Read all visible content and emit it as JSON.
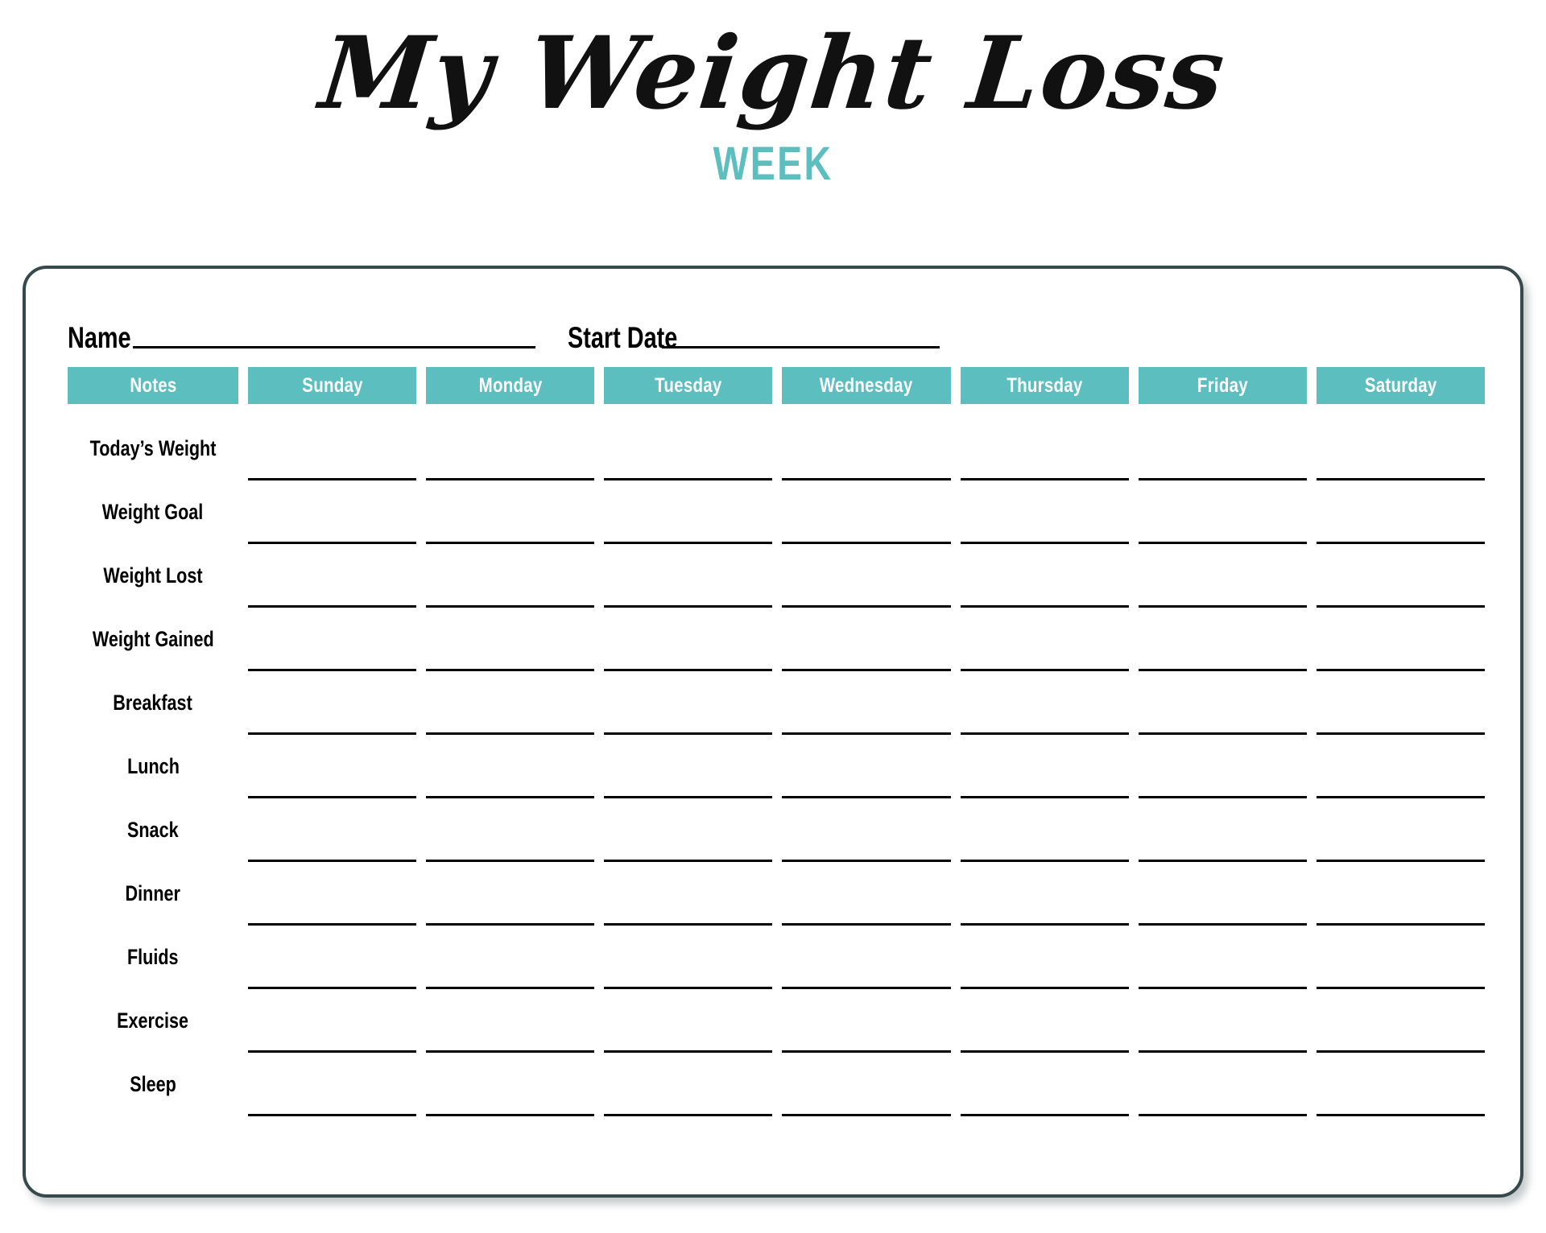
{
  "title": {
    "main": "My Weight Loss",
    "sub": "WEEK"
  },
  "colors": {
    "accent_teal": "#5DBEC0",
    "card_border": "#36494D",
    "text": "#000000",
    "header_text": "#FFFFFF"
  },
  "meta": {
    "name_label": "Name",
    "name_value": "",
    "start_date_label": "Start Date",
    "start_date_value": ""
  },
  "table": {
    "columns": [
      {
        "label": "Notes"
      },
      {
        "label": "Sunday"
      },
      {
        "label": "Monday"
      },
      {
        "label": "Tuesday"
      },
      {
        "label": "Wednesday"
      },
      {
        "label": "Thursday"
      },
      {
        "label": "Friday"
      },
      {
        "label": "Saturday"
      }
    ],
    "rows": [
      {
        "label": "Today’s Weight",
        "values": [
          "",
          "",
          "",
          "",
          "",
          "",
          ""
        ]
      },
      {
        "label": "Weight Goal",
        "values": [
          "",
          "",
          "",
          "",
          "",
          "",
          ""
        ]
      },
      {
        "label": "Weight Lost",
        "values": [
          "",
          "",
          "",
          "",
          "",
          "",
          ""
        ]
      },
      {
        "label": "Weight Gained",
        "values": [
          "",
          "",
          "",
          "",
          "",
          "",
          ""
        ]
      },
      {
        "label": "Breakfast",
        "values": [
          "",
          "",
          "",
          "",
          "",
          "",
          ""
        ]
      },
      {
        "label": "Lunch",
        "values": [
          "",
          "",
          "",
          "",
          "",
          "",
          ""
        ]
      },
      {
        "label": "Snack",
        "values": [
          "",
          "",
          "",
          "",
          "",
          "",
          ""
        ]
      },
      {
        "label": "Dinner",
        "values": [
          "",
          "",
          "",
          "",
          "",
          "",
          ""
        ]
      },
      {
        "label": "Fluids",
        "values": [
          "",
          "",
          "",
          "",
          "",
          "",
          ""
        ]
      },
      {
        "label": "Exercise",
        "values": [
          "",
          "",
          "",
          "",
          "",
          "",
          ""
        ]
      },
      {
        "label": "Sleep",
        "values": [
          "",
          "",
          "",
          "",
          "",
          "",
          ""
        ]
      }
    ]
  }
}
